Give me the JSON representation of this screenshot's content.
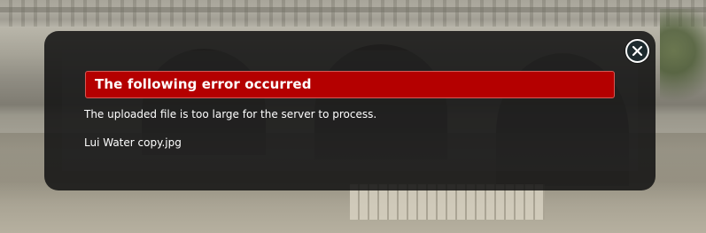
{
  "dialog": {
    "title": "The following error occurred",
    "message": "The uploaded file is too large for the server to process.",
    "file_name": "Lui Water copy.jpg",
    "close_icon": "close-icon"
  },
  "colors": {
    "error_header_bg": "#b40000",
    "dialog_bg": "#121212",
    "text": "#ffffff"
  }
}
